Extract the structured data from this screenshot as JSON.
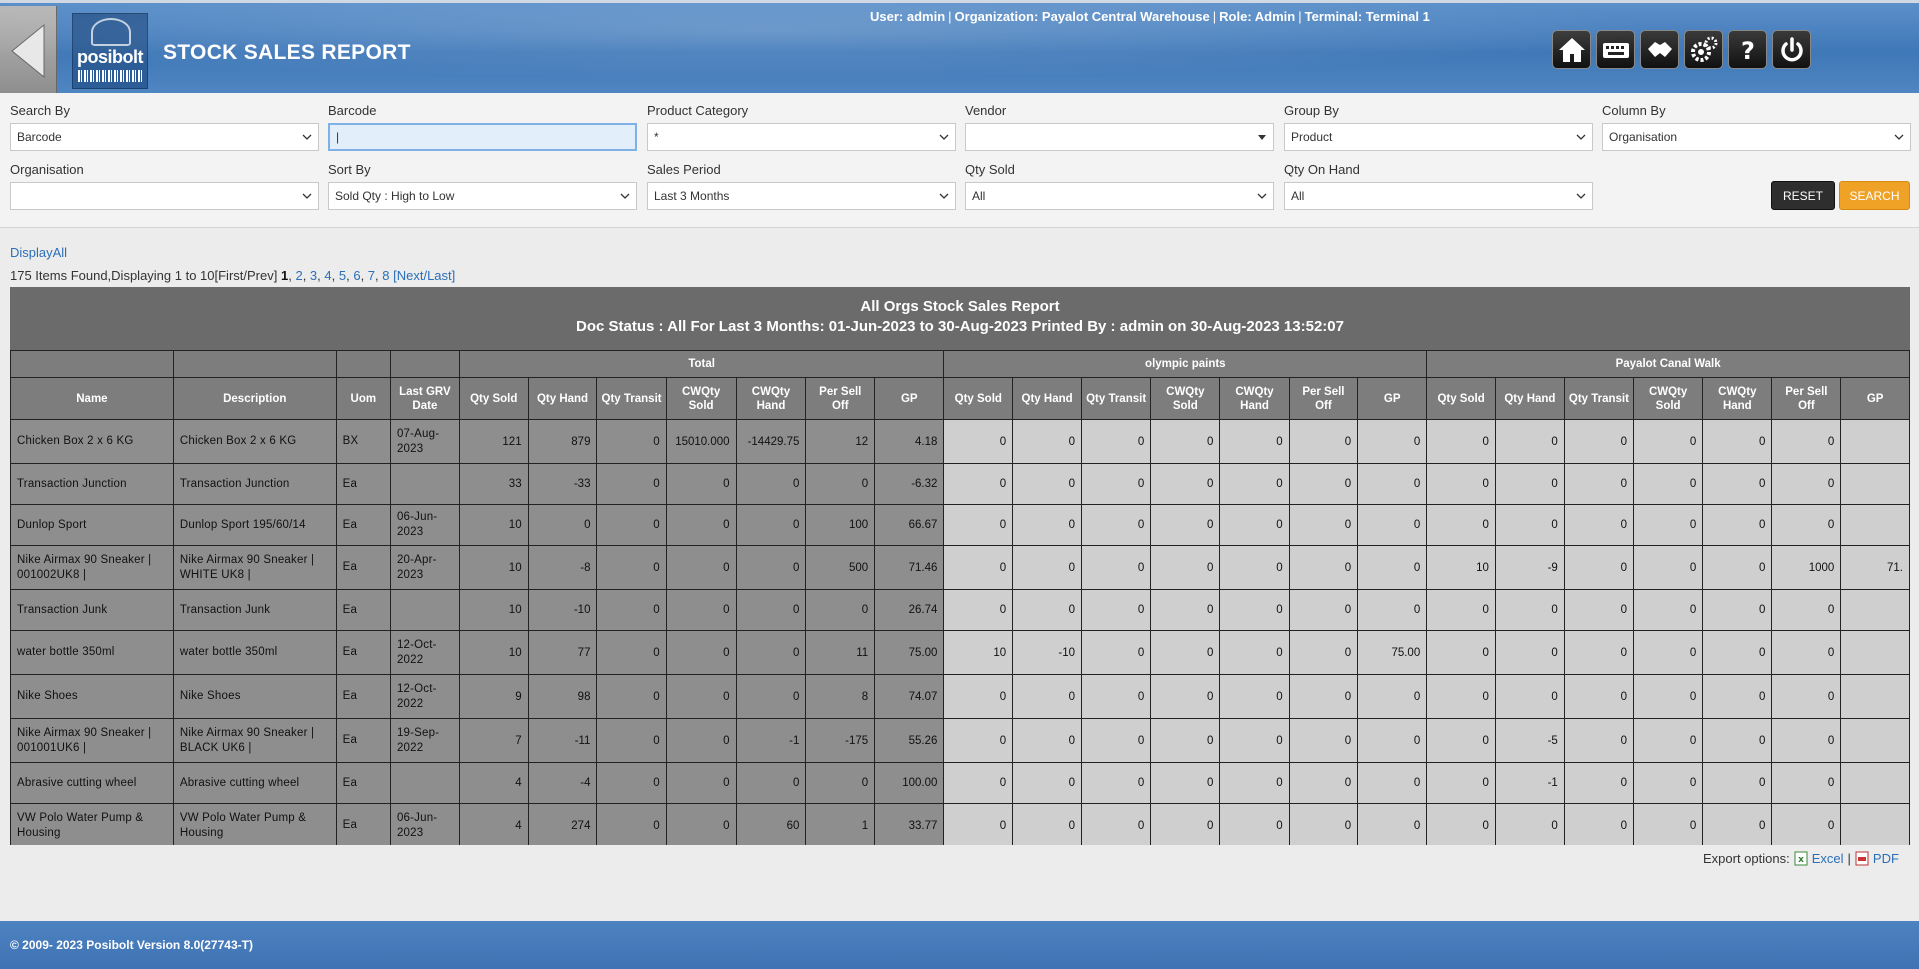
{
  "header": {
    "title": "STOCK SALES REPORT",
    "logo_text": "posibolt",
    "user_info": {
      "user": "User: admin",
      "organization": "Organization: Payalot Central Warehouse",
      "role": "Role: Admin",
      "terminal": "Terminal: Terminal 1"
    },
    "toolbar_icons": [
      "home-icon",
      "keyboard-icon",
      "crm-icon",
      "settings-icon",
      "help-icon",
      "power-icon"
    ]
  },
  "filters": {
    "search_by": {
      "label": "Search By",
      "value": "Barcode"
    },
    "barcode": {
      "label": "Barcode",
      "value": "|"
    },
    "product_category": {
      "label": "Product Category",
      "value": "*"
    },
    "vendor": {
      "label": "Vendor",
      "value": ""
    },
    "group_by": {
      "label": "Group By",
      "value": "Product"
    },
    "column_by": {
      "label": "Column By",
      "value": "Organisation"
    },
    "organisation": {
      "label": "Organisation",
      "value": ""
    },
    "sort_by": {
      "label": "Sort By",
      "value": "Sold Qty : High to Low"
    },
    "sales_period": {
      "label": "Sales Period",
      "value": "Last 3 Months"
    },
    "qty_sold": {
      "label": "Qty Sold",
      "value": "All"
    },
    "qty_on_hand": {
      "label": "Qty On Hand",
      "value": "All"
    },
    "reset_label": "RESET",
    "search_label": "SEARCH"
  },
  "pager": {
    "display_all": "DisplayAll",
    "summary": "175 Items Found,Displaying 1 to 10[First/Prev]",
    "current": "1",
    "pages": [
      "2",
      "3",
      "4",
      "5",
      "6",
      "7",
      "8"
    ],
    "next_last": "[Next/Last]"
  },
  "report": {
    "title": "All Orgs Stock Sales Report",
    "subtitle": "Doc Status : All For Last 3 Months: 01-Jun-2023 to 30-Aug-2023 Printed By : admin on 30-Aug-2023 13:52:07",
    "groups": [
      "Total",
      "olympic paints",
      "Payalot Canal Walk"
    ],
    "base_columns": [
      "Name",
      "Description",
      "Uom",
      "Last GRV Date"
    ],
    "metric_columns": [
      "Qty Sold",
      "Qty Hand",
      "Qty Transit",
      "CWQty Sold",
      "CWQty Hand",
      "Per Sell Off",
      "GP"
    ],
    "rows": [
      {
        "name": "Chicken Box 2 x 6 KG",
        "desc": "Chicken Box 2 x 6 KG",
        "uom": "BX",
        "grv": "07-Aug-2023",
        "total": [
          "121",
          "879",
          "0",
          "15010.000",
          "-14429.75",
          "12",
          "4.18"
        ],
        "olympic": [
          "0",
          "0",
          "0",
          "0",
          "0",
          "0",
          "0"
        ],
        "canal": [
          "0",
          "0",
          "0",
          "0",
          "0",
          "0",
          ""
        ]
      },
      {
        "name": "Transaction Junction",
        "desc": "Transaction Junction",
        "uom": "Ea",
        "grv": "",
        "total": [
          "33",
          "-33",
          "0",
          "0",
          "0",
          "0",
          "-6.32"
        ],
        "olympic": [
          "0",
          "0",
          "0",
          "0",
          "0",
          "0",
          "0"
        ],
        "canal": [
          "0",
          "0",
          "0",
          "0",
          "0",
          "0",
          ""
        ]
      },
      {
        "name": "Dunlop Sport",
        "desc": "Dunlop Sport 195/60/14",
        "uom": "Ea",
        "grv": "06-Jun-2023",
        "total": [
          "10",
          "0",
          "0",
          "0",
          "0",
          "100",
          "66.67"
        ],
        "olympic": [
          "0",
          "0",
          "0",
          "0",
          "0",
          "0",
          "0"
        ],
        "canal": [
          "0",
          "0",
          "0",
          "0",
          "0",
          "0",
          ""
        ]
      },
      {
        "name": "Nike Airmax 90 Sneaker | 001002UK8 |",
        "desc": "Nike Airmax 90 Sneaker | WHITE UK8 |",
        "uom": "Ea",
        "grv": "20-Apr-2023",
        "total": [
          "10",
          "-8",
          "0",
          "0",
          "0",
          "500",
          "71.46"
        ],
        "olympic": [
          "0",
          "0",
          "0",
          "0",
          "0",
          "0",
          "0"
        ],
        "canal": [
          "10",
          "-9",
          "0",
          "0",
          "0",
          "1000",
          "71."
        ]
      },
      {
        "name": "Transaction Junk",
        "desc": "Transaction Junk",
        "uom": "Ea",
        "grv": "",
        "total": [
          "10",
          "-10",
          "0",
          "0",
          "0",
          "0",
          "26.74"
        ],
        "olympic": [
          "0",
          "0",
          "0",
          "0",
          "0",
          "0",
          "0"
        ],
        "canal": [
          "0",
          "0",
          "0",
          "0",
          "0",
          "0",
          ""
        ]
      },
      {
        "name": "water bottle 350ml",
        "desc": "water bottle 350ml",
        "uom": "Ea",
        "grv": "12-Oct-2022",
        "total": [
          "10",
          "77",
          "0",
          "0",
          "0",
          "11",
          "75.00"
        ],
        "olympic": [
          "10",
          "-10",
          "0",
          "0",
          "0",
          "0",
          "75.00"
        ],
        "canal": [
          "0",
          "0",
          "0",
          "0",
          "0",
          "0",
          ""
        ]
      },
      {
        "name": "Nike Shoes",
        "desc": "Nike Shoes",
        "uom": "Ea",
        "grv": "12-Oct-2022",
        "total": [
          "9",
          "98",
          "0",
          "0",
          "0",
          "8",
          "74.07"
        ],
        "olympic": [
          "0",
          "0",
          "0",
          "0",
          "0",
          "0",
          "0"
        ],
        "canal": [
          "0",
          "0",
          "0",
          "0",
          "0",
          "0",
          ""
        ]
      },
      {
        "name": "Nike Airmax 90 Sneaker | 001001UK6 |",
        "desc": "Nike Airmax 90 Sneaker | BLACK UK6 |",
        "uom": "Ea",
        "grv": "19-Sep-2022",
        "total": [
          "7",
          "-11",
          "0",
          "0",
          "-1",
          "-175",
          "55.26"
        ],
        "olympic": [
          "0",
          "0",
          "0",
          "0",
          "0",
          "0",
          "0"
        ],
        "canal": [
          "0",
          "-5",
          "0",
          "0",
          "0",
          "0",
          ""
        ]
      },
      {
        "name": "Abrasive cutting wheel",
        "desc": "Abrasive cutting wheel",
        "uom": "Ea",
        "grv": "",
        "total": [
          "4",
          "-4",
          "0",
          "0",
          "0",
          "0",
          "100.00"
        ],
        "olympic": [
          "0",
          "0",
          "0",
          "0",
          "0",
          "0",
          "0"
        ],
        "canal": [
          "0",
          "-1",
          "0",
          "0",
          "0",
          "0",
          ""
        ]
      },
      {
        "name": "VW Polo Water Pump & Housing",
        "desc": "VW Polo Water Pump & Housing",
        "uom": "Ea",
        "grv": "06-Jun-2023",
        "total": [
          "4",
          "274",
          "0",
          "0",
          "60",
          "1",
          "33.77"
        ],
        "olympic": [
          "0",
          "0",
          "0",
          "0",
          "0",
          "0",
          "0"
        ],
        "canal": [
          "0",
          "0",
          "0",
          "0",
          "0",
          "0",
          ""
        ]
      }
    ]
  },
  "export": {
    "label": "Export options:",
    "excel": "Excel",
    "separator": "|",
    "pdf": "PDF"
  },
  "footer": {
    "text": "© 2009- 2023 Posibolt Version  8.0(27743-T)"
  },
  "colors": {
    "header_blue": "#4a80bf",
    "search_orange": "#f0a226",
    "report_head": "#6b6b6b"
  }
}
